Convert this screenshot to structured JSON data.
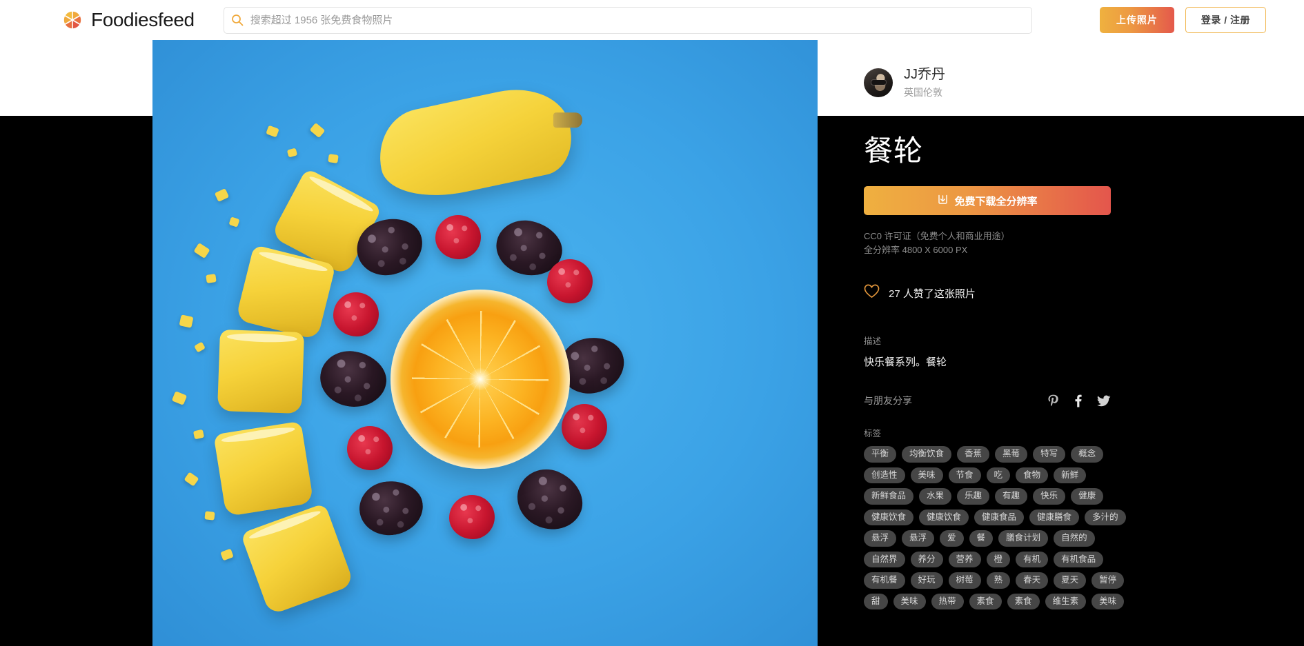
{
  "header": {
    "brand_name": "Foodiesfeed",
    "brand_icon": "aperture-logo-icon",
    "search": {
      "icon": "search-icon",
      "placeholder": "搜索超过 1956 张免费食物照片",
      "value": ""
    },
    "upload_label": "上传照片",
    "login_label": "登录 / 注册"
  },
  "author": {
    "avatar_icon": "avatar",
    "name": "JJ乔丹",
    "location": "英国伦敦"
  },
  "photo": {
    "title": "餐轮",
    "alt": "蓝色背景上的香蕉块、黑莓、树莓与橙子切片组成的圆环"
  },
  "download": {
    "icon": "download-icon",
    "label": "免费下载全分辨率"
  },
  "license": {
    "line1": "CC0 许可证（免费个人和商业用途）",
    "line2": "全分辨率 4800 X 6000 PX"
  },
  "likes": {
    "icon": "heart-icon",
    "text": "27 人赞了这张照片"
  },
  "description": {
    "label": "描述",
    "text": "快乐餐系列。餐轮"
  },
  "share": {
    "label": "与朋友分享",
    "icons": [
      "pinterest-icon",
      "facebook-icon",
      "twitter-icon"
    ]
  },
  "tags": {
    "label": "标签",
    "items": [
      "平衡",
      "均衡饮食",
      "香蕉",
      "黑莓",
      "特写",
      "概念",
      "创造性",
      "美味",
      "节食",
      "吃",
      "食物",
      "新鲜",
      "新鲜食品",
      "水果",
      "乐趣",
      "有趣",
      "快乐",
      "健康",
      "健康饮食",
      "健康饮食",
      "健康食品",
      "健康膳食",
      "多汁的",
      "悬浮",
      "悬浮",
      "爱",
      "餐",
      "膳食计划",
      "自然的",
      "自然界",
      "养分",
      "营养",
      "橙",
      "有机",
      "有机食品",
      "有机餐",
      "好玩",
      "树莓",
      "熟",
      "春天",
      "夏天",
      "暂停",
      "甜",
      "美味",
      "热带",
      "素食",
      "素食",
      "维生素",
      "美味"
    ]
  },
  "colors": {
    "accent_orange": "#efb040",
    "accent_red": "#e4564c",
    "photo_background": "#3fa7e8",
    "tag_background": "#464646",
    "panel_background": "#000000"
  }
}
